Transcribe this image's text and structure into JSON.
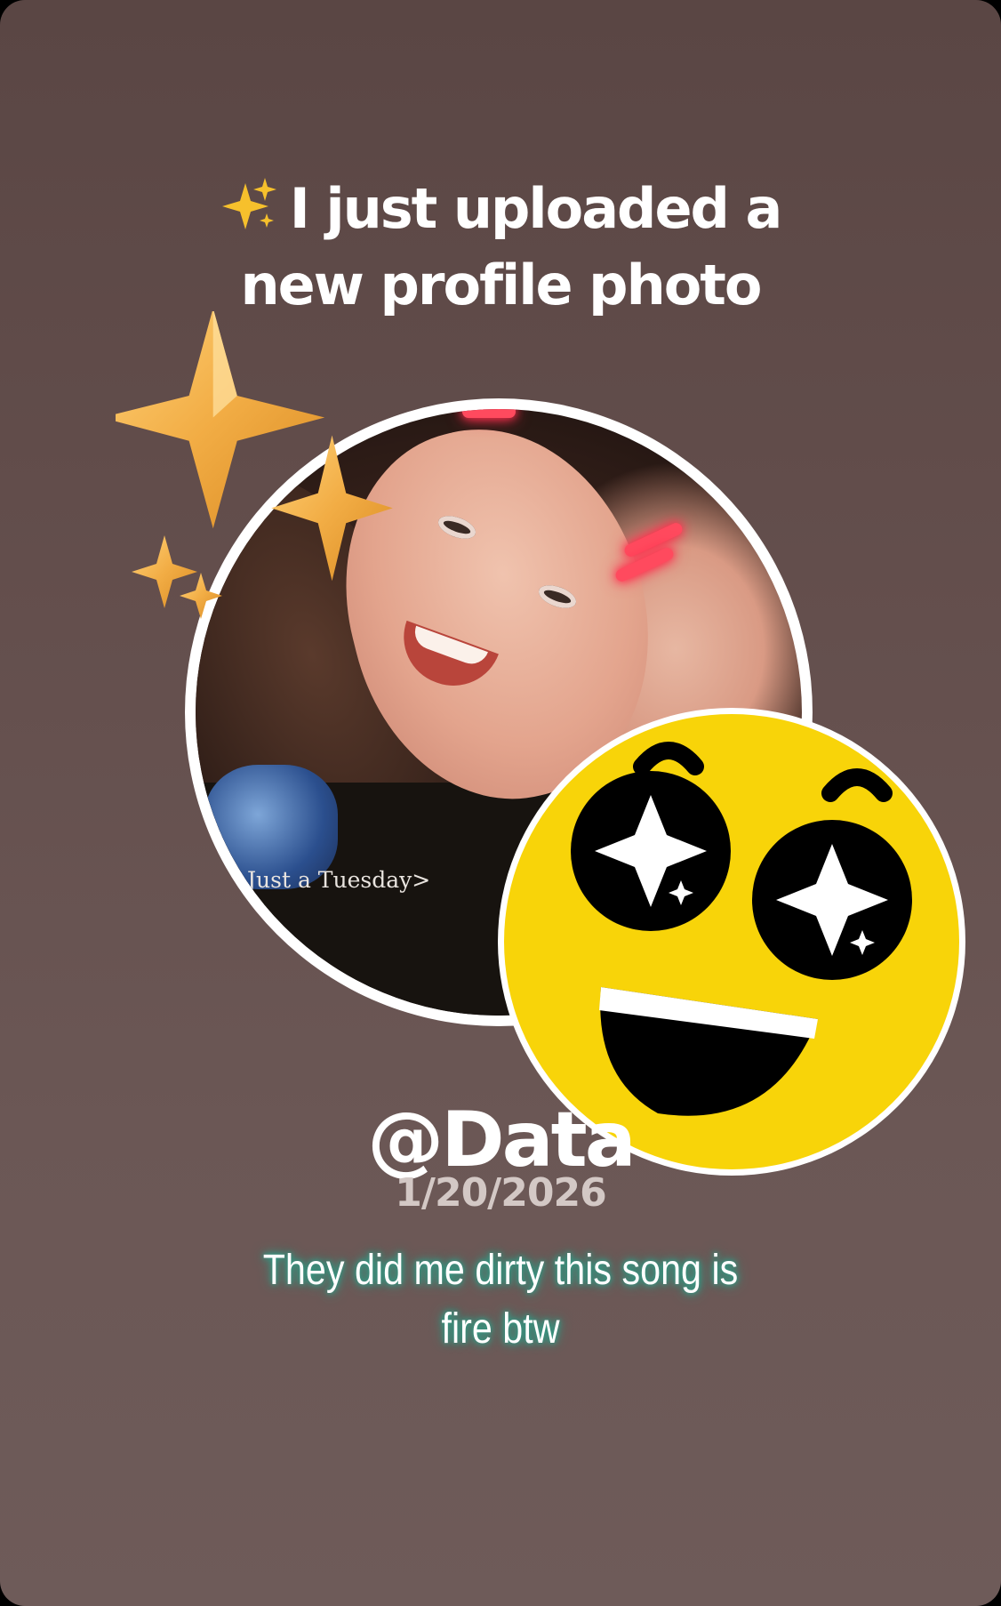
{
  "story": {
    "headline_line1": "I just uploaded a",
    "headline_line2": "new profile photo",
    "headline_icon": "sparkles-emoji",
    "photo_caption": "Just a Tuesday>",
    "handle": "@Data",
    "date": "1/20/2026",
    "comment_line1": "They did me dirty this song is",
    "comment_line2": "fire btw"
  },
  "stickers": {
    "stars": "gold-stars-sticker",
    "emoji": "star-struck-smiley-sticker"
  },
  "colors": {
    "background_top": "#5a4644",
    "background_bottom": "#6e5b59",
    "star_gold": "#f1ae46",
    "emoji_yellow": "#f8d409",
    "comment_glow": "#2f9c86"
  }
}
